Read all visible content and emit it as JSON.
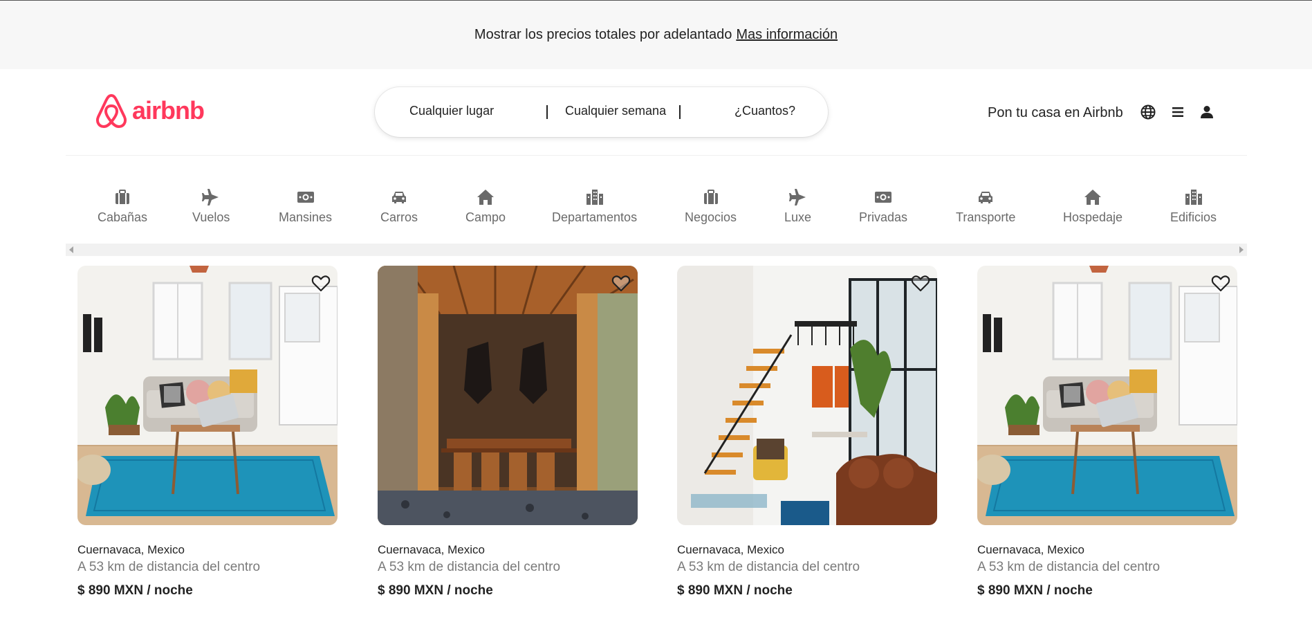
{
  "banner": {
    "text": "Mostrar los precios totales por adelantado",
    "link": "Mas información"
  },
  "header": {
    "logo_text": "airbnb",
    "brand_color": "#FF385C",
    "search": {
      "place": "Cualquier lugar",
      "week": "Cualquier semana",
      "guests": "¿Cuantos?"
    },
    "host_link": "Pon tu casa en Airbnb",
    "icons": [
      "globe-icon",
      "menu-icon",
      "user-icon"
    ]
  },
  "categories": [
    {
      "label": "Cabañas",
      "icon": "briefcase-icon"
    },
    {
      "label": "Vuelos",
      "icon": "plane-icon"
    },
    {
      "label": "Mansines",
      "icon": "money-icon"
    },
    {
      "label": "Carros",
      "icon": "car-icon"
    },
    {
      "label": "Campo",
      "icon": "house-icon"
    },
    {
      "label": "Departamentos",
      "icon": "buildings-icon"
    },
    {
      "label": "Negocios",
      "icon": "briefcase-icon"
    },
    {
      "label": "Luxe",
      "icon": "plane-icon"
    },
    {
      "label": "Privadas",
      "icon": "money-icon"
    },
    {
      "label": "Transporte",
      "icon": "car-icon"
    },
    {
      "label": "Hospedaje",
      "icon": "house-icon"
    },
    {
      "label": "Edificios",
      "icon": "buildings-icon"
    }
  ],
  "listings": [
    {
      "location": "Cuernavaca, Mexico",
      "distance": "A 53 km de distancia del centro",
      "price": "$ 890 MXN / noche",
      "photo": "living-room-photo"
    },
    {
      "location": "Cuernavaca, Mexico",
      "distance": "A 53 km de distancia del centro",
      "price": "$ 890 MXN / noche",
      "photo": "dining-room-photo"
    },
    {
      "location": "Cuernavaca, Mexico",
      "distance": "A 53 km de distancia del centro",
      "price": "$ 890 MXN / noche",
      "photo": "staircase-loft-photo"
    },
    {
      "location": "Cuernavaca, Mexico",
      "distance": "A 53 km de distancia del centro",
      "price": "$ 890 MXN / noche",
      "photo": "living-room-photo"
    }
  ]
}
